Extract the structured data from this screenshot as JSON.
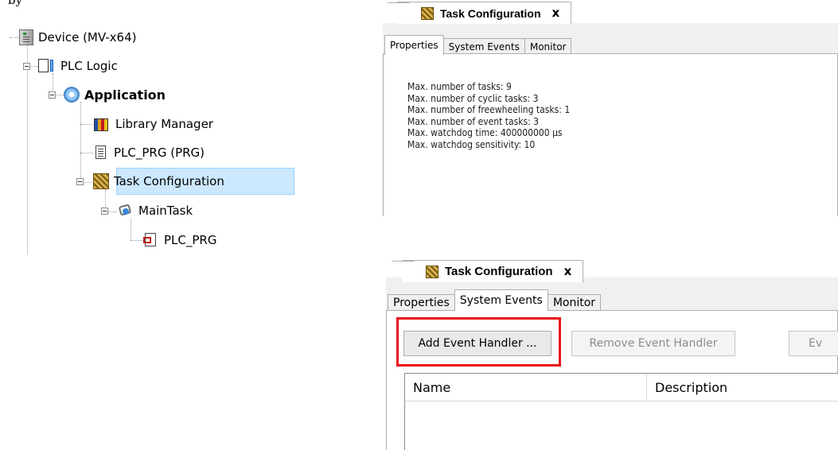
{
  "top_fragment": "by",
  "tree": {
    "items": [
      {
        "label": "Device (MV-x64)",
        "icon": "device-icon"
      },
      {
        "label": "PLC Logic",
        "icon": "plc-logic-icon"
      },
      {
        "label": "Application",
        "icon": "application-gear-icon"
      },
      {
        "label": "Library Manager",
        "icon": "library-manager-icon"
      },
      {
        "label": "PLC_PRG (PRG)",
        "icon": "program-document-icon"
      },
      {
        "label": "Task Configuration",
        "icon": "task-configuration-icon",
        "selected": true
      },
      {
        "label": "MainTask",
        "icon": "main-task-icon"
      },
      {
        "label": "PLC_PRG",
        "icon": "program-call-icon"
      }
    ]
  },
  "panel_top": {
    "doc_tab": {
      "title": "Task Configuration",
      "close": "x"
    },
    "tabs": [
      "Properties",
      "System Events",
      "Monitor"
    ],
    "active_tab": "Properties",
    "lines": [
      "Max. number of tasks: 9",
      "Max. number of cyclic tasks: 3",
      "Max. number of freewheeling tasks: 1",
      "Max. number of event tasks: 3",
      "Max. watchdog time: 400000000 µs",
      "Max. watchdog sensitivity: 10"
    ]
  },
  "panel_bottom": {
    "doc_tab": {
      "title": "Task Configuration",
      "close": "x"
    },
    "tabs": [
      "Properties",
      "System Events",
      "Monitor"
    ],
    "active_tab": "System Events",
    "buttons": {
      "add": "Add Event Handler ...",
      "remove": "Remove Event Handler",
      "cut": "Ev"
    },
    "highlight_color": "#e8141b",
    "columns": [
      "Name",
      "Description"
    ]
  }
}
